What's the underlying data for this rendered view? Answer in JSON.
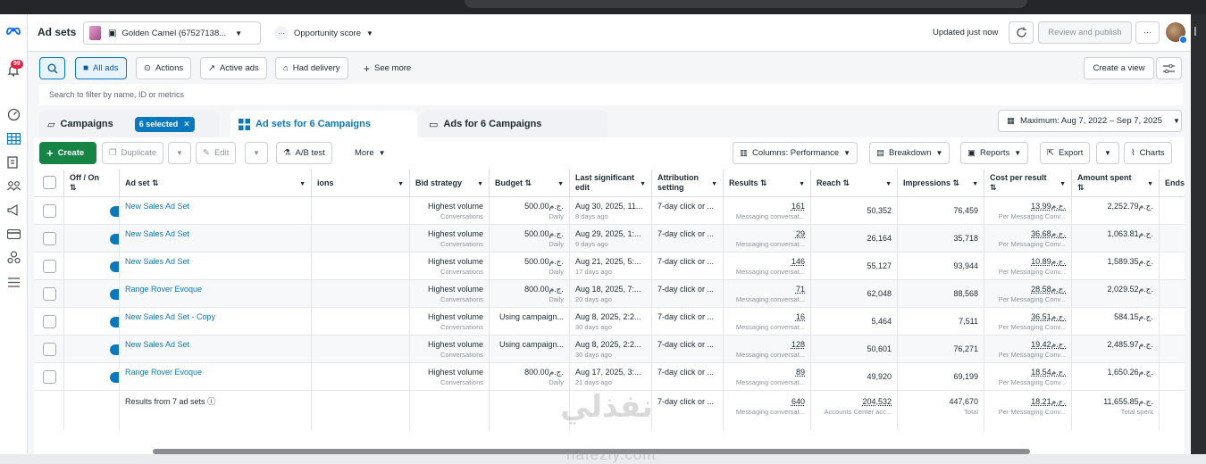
{
  "header": {
    "title": "Ad sets",
    "account_name": "Golden Camel (67527138...",
    "opportunity_label": "Opportunity score",
    "updated_text": "Updated just now",
    "review_publish_label": "Review and publish",
    "notification_count": "99"
  },
  "filterbar": {
    "all_ads": "All ads",
    "actions": "Actions",
    "active_ads": "Active ads",
    "had_delivery": "Had delivery",
    "see_more": "See more",
    "create_view": "Create a view",
    "search_placeholder": "Search to filter by name, ID or metrics"
  },
  "tabs": {
    "campaigns": "Campaigns",
    "selected_badge": "6 selected",
    "adsets": "Ad sets for 6 Campaigns",
    "ads": "Ads for 6 Campaigns",
    "date_range": "Maximum: Aug 7, 2022 – Sep 7, 2025"
  },
  "toolbar": {
    "create": "Create",
    "duplicate": "Duplicate",
    "edit": "Edit",
    "ab_test": "A/B test",
    "more": "More",
    "columns": "Columns: Performance",
    "breakdown": "Breakdown",
    "reports": "Reports",
    "export": "Export",
    "charts": "Charts"
  },
  "columns": {
    "off_on": "Off / On",
    "adset": "Ad set",
    "delivery": "ions",
    "bid_strategy": "Bid strategy",
    "budget": "Budget",
    "last_edit": "Last significant edit",
    "attribution": "Attribution setting",
    "results": "Results",
    "reach": "Reach",
    "impressions": "Impressions",
    "cost_per_result": "Cost per result",
    "amount_spent": "Amount spent",
    "ends": "Ends"
  },
  "rows": [
    {
      "name": "New Sales Ad Set",
      "bid": "Highest volume",
      "bid_sub": "Conversations",
      "budget": "500.00",
      "budget_sub": "Daily",
      "edit": "Aug 30, 2025, 11...",
      "edit_sub": "8 days ago",
      "attr": "7-day click or ...",
      "results": "161",
      "results_sub": "Messaging conversat...",
      "reach": "50,352",
      "impressions": "76,459",
      "cpr": "13.99",
      "cpr_sub": "Per Messaging Conv...",
      "spent": "2,252.79"
    },
    {
      "name": "New Sales Ad Set",
      "bid": "Highest volume",
      "bid_sub": "Conversations",
      "budget": "500.00",
      "budget_sub": "Daily",
      "edit": "Aug 29, 2025, 1:...",
      "edit_sub": "9 days ago",
      "attr": "7-day click or ...",
      "results": "29",
      "results_sub": "Messaging conversat...",
      "reach": "26,164",
      "impressions": "35,718",
      "cpr": "36.68",
      "cpr_sub": "Per Messaging Conv...",
      "spent": "1,063.81"
    },
    {
      "name": "New Sales Ad Set",
      "bid": "Highest volume",
      "bid_sub": "Conversations",
      "budget": "500.00",
      "budget_sub": "Daily",
      "edit": "Aug 21, 2025, 5:...",
      "edit_sub": "17 days ago",
      "attr": "7-day click or ...",
      "results": "146",
      "results_sub": "Messaging conversat...",
      "reach": "55,127",
      "impressions": "93,944",
      "cpr": "10.89",
      "cpr_sub": "Per Messaging Conv...",
      "spent": "1,589.35"
    },
    {
      "name": "Range Rover Evoque",
      "bid": "Highest volume",
      "bid_sub": "Conversations",
      "budget": "800.00",
      "budget_sub": "Daily",
      "edit": "Aug 18, 2025, 7:...",
      "edit_sub": "20 days ago",
      "attr": "7-day click or ...",
      "results": "71",
      "results_sub": "Messaging conversat...",
      "reach": "62,048",
      "impressions": "88,568",
      "cpr": "28.58",
      "cpr_sub": "Per Messaging Conv...",
      "spent": "2,029.52"
    },
    {
      "name": "New Sales Ad Set - Copy",
      "bid": "Highest volume",
      "bid_sub": "Conversations",
      "budget": "Using campaign...",
      "budget_sub": "",
      "edit": "Aug 8, 2025, 2:2...",
      "edit_sub": "30 days ago",
      "attr": "7-day click or ...",
      "results": "16",
      "results_sub": "Messaging conversat...",
      "reach": "5,464",
      "impressions": "7,511",
      "cpr": "36.51",
      "cpr_sub": "Per Messaging Conv...",
      "spent": "584.15"
    },
    {
      "name": "New Sales Ad Set",
      "bid": "Highest volume",
      "bid_sub": "Conversations",
      "budget": "Using campaign...",
      "budget_sub": "",
      "edit": "Aug 8, 2025, 2:2...",
      "edit_sub": "30 days ago",
      "attr": "7-day click or ...",
      "results": "128",
      "results_sub": "Messaging conversat...",
      "reach": "50,601",
      "impressions": "76,271",
      "cpr": "19.42",
      "cpr_sub": "Per Messaging Conv...",
      "spent": "2,485.97"
    },
    {
      "name": "Range Rover Evoque",
      "bid": "Highest volume",
      "bid_sub": "Conversations",
      "budget": "800.00",
      "budget_sub": "Daily",
      "edit": "Aug 17, 2025, 3:...",
      "edit_sub": "21 days ago",
      "attr": "7-day click or ...",
      "results": "89",
      "results_sub": "Messaging conversat...",
      "reach": "49,920",
      "impressions": "69,199",
      "cpr": "18.54",
      "cpr_sub": "Per Messaging Conv...",
      "spent": "1,650.26"
    }
  ],
  "currency": "ج.م.",
  "footer": {
    "label": "Results from 7 ad sets",
    "attr": "7-day click or ...",
    "results": "640",
    "results_sub": "Messaging conversat...",
    "reach": "204,532",
    "reach_sub": "Accounts Center acc...",
    "impressions": "447,670",
    "impressions_sub": "Total",
    "cpr": "18.21",
    "cpr_sub": "Per Messaging Conv...",
    "spent": "11,655.85",
    "spent_sub": "Total spent"
  },
  "watermark": {
    "arabic": "نفذلي",
    "latin": "nafezly.com"
  },
  "colors": {
    "brand_blue": "#0a78be",
    "create_green": "#168444",
    "meta_blue": "#0866ff"
  }
}
